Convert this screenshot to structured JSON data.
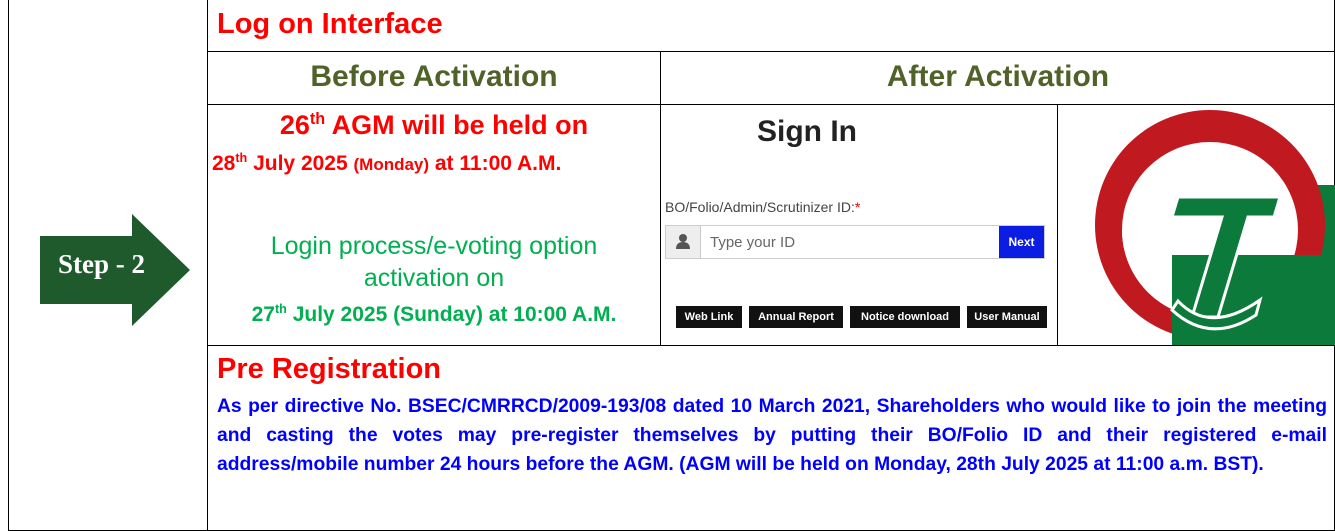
{
  "step_label": "Step - 2",
  "section_title": "Log on Interface",
  "before_header": "Before Activation",
  "after_header": "After Activation",
  "agm": {
    "num": "26",
    "num_sup": "th",
    "line1_rest": " AGM will be held on",
    "date_day": "28",
    "date_sup": "th",
    "date_rest": " July 2025 ",
    "date_weekday": "(Monday)",
    "date_time": " at 11:00 A.M."
  },
  "activation": {
    "line1": "Login process/e-voting option",
    "line2": "activation on",
    "day": "27",
    "day_sup": "th",
    "rest": " July 2025 (Sunday) at 10:00 A.M."
  },
  "signin": {
    "title": "Sign In",
    "id_label": "BO/Folio/Admin/Scrutinizer ID:",
    "required_mark": "*",
    "placeholder": "Type your ID",
    "next_label": "Next",
    "user_icon": "user-icon",
    "buttons": [
      "Web Link",
      "Annual Report",
      "Notice download",
      "User Manual"
    ]
  },
  "logo_icon": "company-logo",
  "pre_registration": {
    "title": "Pre Registration",
    "text": "As per directive No. BSEC/CMRRCD/2009-193/08 dated 10 March 2021, Shareholders who would like to join the meeting and casting the votes may pre-register themselves by putting their BO/Folio ID and their registered e-mail address/mobile number 24 hours before the AGM. (AGM will be held on Monday, 28th July 2025 at 11:00 a.m. BST)."
  },
  "colors": {
    "step_arrow": "#1e5a2c",
    "title_red": "#ff0000",
    "header_olive": "#4f6228",
    "activation_green": "#00b050",
    "pre_text_blue": "#0000ff",
    "next_button": "#0a1de0",
    "logo_red": "#c0191f",
    "logo_green": "#0c7a3a"
  }
}
